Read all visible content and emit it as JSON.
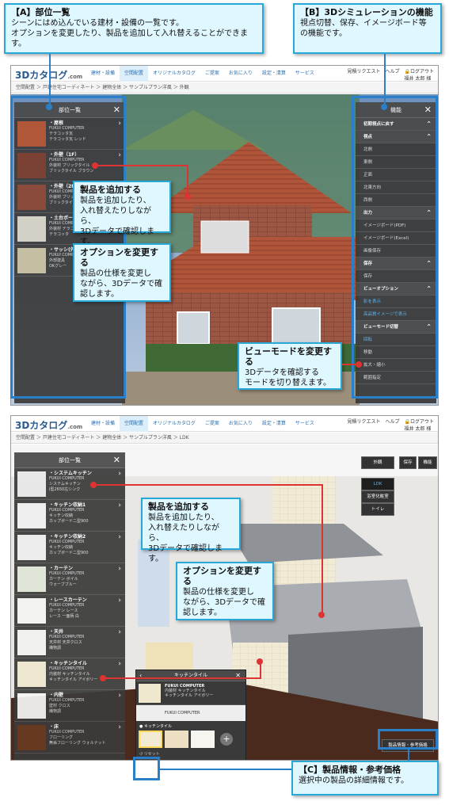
{
  "callouts": {
    "a_title": "【A】部位一覧",
    "a_body1": "シーンにはめ込んでいる建材・設備の一覧です。",
    "a_body2": "オプションを変更したり、製品を追加して入れ替えることができます。",
    "b_title": "【B】3Dシミュレーションの機能",
    "b_body1": "視点切替、保存、イメージボード等",
    "b_body2": "の機能です。",
    "add_title": "製品を追加する",
    "add_body1": "製品を追加したり、",
    "add_body2": "入れ替えたりしながら、",
    "add_body3": "3Dデータで確認します。",
    "opt_title": "オプションを変更する",
    "opt_body1": "製品の仕様を変更し",
    "opt_body2": "ながら、3Dデータで確",
    "opt_body3": "認します。",
    "view_title": "ビューモードを変更する",
    "view_body1": "3Dデータを確認する",
    "view_body2": "モードを切り替えます。",
    "c_title": "【C】製品情報・参考価格",
    "c_body": "選択中の製品の詳細情報です。"
  },
  "app": {
    "logo": "3Dカタログ",
    "logo_suffix": ".com",
    "nav": [
      "建材・設備",
      "空間配置",
      "オリジナルカタログ",
      "ご提案",
      "お気に入り",
      "設定・清算",
      "サービス"
    ],
    "top_right": [
      "見積リクエスト",
      "ヘルプ",
      "ログアウト"
    ],
    "user": "福井 太郎 様"
  },
  "shot1": {
    "breadcrumb": "空間配置 ＞ 戸建住宅コーディネート ＞ 建物全体 ＞ サンプルプラン洋風 ＞ 外観",
    "panel_title": "部位一覧",
    "items": [
      {
        "name": "・屋根",
        "l1": "FUKUI COMPUTER",
        "l2": "テラコッタ瓦",
        "l3": "テラコッタ瓦 レッド",
        "color": "#b5532f"
      },
      {
        "name": "・外壁（1F）",
        "l1": "FUKUI COMPUTER",
        "l2": "外装材 ブリックタイル",
        "l3": "ブリックタイル ブラウン",
        "color": "#7a3b2a"
      },
      {
        "name": "・外壁（2F）",
        "l1": "FUKUI COMPUTER",
        "l2": "外装材 ブリックタイル",
        "l3": "ブリックタイル",
        "color": "#8c4532"
      },
      {
        "name": "・土台ボーダー",
        "l1": "FUKUI COMPUTER",
        "l2": "外装材 テラコッタ",
        "l3": "テラコッタ",
        "color": "#d9d4c6"
      },
      {
        "name": "・サッシ(外)",
        "l1": "FUKUI COMPUTER",
        "l2": "外部建具",
        "l3": "OKグレー",
        "color": "#c8c0a0"
      }
    ],
    "func_title": "機能",
    "func_rows": [
      {
        "t": "初期視点に戻す",
        "k": "sec"
      },
      {
        "t": "視点",
        "k": "sec"
      },
      {
        "t": "北側",
        "k": ""
      },
      {
        "t": "東側",
        "k": ""
      },
      {
        "t": "正面",
        "k": ""
      },
      {
        "t": "北東方向",
        "k": ""
      },
      {
        "t": "西側",
        "k": ""
      },
      {
        "t": "出力",
        "k": "sec"
      },
      {
        "t": "イメージボード(PDF)",
        "k": ""
      },
      {
        "t": "イメージボード(Excel)",
        "k": ""
      },
      {
        "t": "画像保存",
        "k": ""
      },
      {
        "t": "保存",
        "k": "sec"
      },
      {
        "t": "保存",
        "k": ""
      },
      {
        "t": "ビューオプション",
        "k": "sec"
      },
      {
        "t": "影を表示",
        "k": "blue"
      },
      {
        "t": "高品質イメージで表示",
        "k": "blue"
      },
      {
        "t": "ビューモード切替",
        "k": "sec"
      },
      {
        "t": "回転",
        "k": "blue"
      },
      {
        "t": "移動",
        "k": ""
      },
      {
        "t": "拡大・縮小",
        "k": ""
      },
      {
        "t": "範囲指定",
        "k": ""
      }
    ]
  },
  "shot2": {
    "breadcrumb": "空間配置 ＞ 戸建住宅コーディネート ＞ 建物全体 ＞ サンプルプラン洋風 ＞ LDK",
    "panel_title": "部位一覧",
    "items": [
      {
        "name": "・システムキッチン",
        "l1": "FUKUI COMPUTER",
        "l2": "システムキッチン",
        "l3": "I型2650左シンク",
        "color": "#e8e8e8"
      },
      {
        "name": "・キッチン収納1",
        "l1": "FUKUI COMPUTER",
        "l2": "キッチン収納",
        "l3": "カップボード二型900",
        "color": "#f0f0f0"
      },
      {
        "name": "・キッチン収納2",
        "l1": "FUKUI COMPUTER",
        "l2": "キッチン収納",
        "l3": "カップボード二型900",
        "color": "#eeeeee"
      },
      {
        "name": "・カーテン",
        "l1": "FUKUI COMPUTER",
        "l2": "カーテン ボイル",
        "l3": "ウォーブブルー",
        "color": "#dfe6d8"
      },
      {
        "name": "・レースカーテン",
        "l1": "FUKUI COMPUTER",
        "l2": "カーテン レース",
        "l3": "レース 一面柄 白",
        "color": "#f4f4f4"
      },
      {
        "name": "・天井",
        "l1": "FUKUI COMPUTER",
        "l2": "天井材 天井クロス",
        "l3": "織物調",
        "color": "#f2f2f2"
      },
      {
        "name": "・キッチンタイル",
        "l1": "FUKUI COMPUTER",
        "l2": "内装材 キッチンタイル",
        "l3": "キッチンタイル アイボリー",
        "color": "#efe8cf"
      },
      {
        "name": "・内壁",
        "l1": "FUKUI COMPUTER",
        "l2": "壁材 クロス",
        "l3": "織物調",
        "color": "#f5f5f5"
      },
      {
        "name": "・床",
        "l1": "FUKUI COMPUTER",
        "l2": "フローリング",
        "l3": "無垢フローリング ウォルナット",
        "color": "#6b3b22"
      }
    ],
    "popup": {
      "title": "キッチンタイル",
      "l1": "FUKUI COMPUTER",
      "l2": "内装材 キッチンタイル",
      "l3": "キッチンタイル アイボリー",
      "maker": "FUKUI COMPUTER",
      "option": "● キッチンタイル",
      "reset": "リセット"
    },
    "views": [
      "外観",
      "LDK",
      "浴室化粧室",
      "トイレ"
    ],
    "buttons": [
      "保存",
      "機能"
    ],
    "info_btn": "製品情報・参考価格"
  }
}
